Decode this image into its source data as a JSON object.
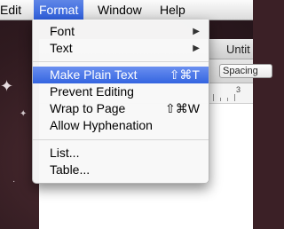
{
  "menubar": {
    "items": [
      {
        "label": "Edit"
      },
      {
        "label": "Format"
      },
      {
        "label": "Window"
      },
      {
        "label": "Help"
      }
    ]
  },
  "document": {
    "title": "Untit",
    "toolbar": {
      "spacing_label": "Spacing"
    },
    "ruler": {
      "marks": [
        "3"
      ]
    }
  },
  "format_menu": {
    "items": [
      {
        "label": "Font",
        "submenu_icon": "chevron-right-icon"
      },
      {
        "label": "Text",
        "submenu_icon": "chevron-right-icon"
      },
      {
        "label": "Make Plain Text",
        "shortcut": "⇧⌘T"
      },
      {
        "label": "Prevent Editing"
      },
      {
        "label": "Wrap to Page",
        "shortcut": "⇧⌘W"
      },
      {
        "label": "Allow Hyphenation"
      },
      {
        "label": "List..."
      },
      {
        "label": "Table..."
      }
    ]
  },
  "colors": {
    "highlight": "#3465e0",
    "desktop": "#3b2026"
  }
}
